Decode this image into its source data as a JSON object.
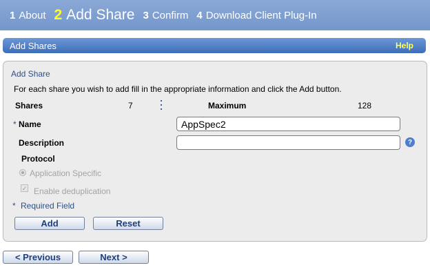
{
  "wizard": {
    "steps": [
      {
        "num": "1",
        "label": "About"
      },
      {
        "num": "2",
        "label": "Add Share"
      },
      {
        "num": "3",
        "label": "Confirm"
      },
      {
        "num": "4",
        "label": "Download Client Plug-In"
      }
    ],
    "active_step": 2
  },
  "section": {
    "title": "Add Shares",
    "help_label": "Help"
  },
  "panel": {
    "title": "Add Share",
    "instructions": "For each share you wish to add fill in the appropriate information and click the Add button.",
    "shares_label": "Shares",
    "shares_value": "7",
    "maximum_label": "Maximum",
    "maximum_value": "128",
    "name_asterisk": "*",
    "name_label": "Name",
    "name_value": "AppSpec2",
    "description_label": "Description",
    "description_value": "",
    "help_icon_glyph": "?",
    "protocol_label": "Protocol",
    "protocol_option": "Application Specific",
    "dedup_label": "Enable deduplication",
    "dedup_checked_glyph": "✓",
    "required_asterisk": "*",
    "required_label": "Required Field",
    "add_button": "Add",
    "reset_button": "Reset"
  },
  "nav": {
    "previous_label": "< Previous",
    "next_label": "Next >"
  },
  "colors": {
    "wizard_bar": "#7d9ed0",
    "active_step_number": "#ffff33",
    "section_bar": "#4f7fc6",
    "help_link": "#ffff66",
    "panel_background": "#ececec",
    "link_blue": "#2e4f86"
  }
}
